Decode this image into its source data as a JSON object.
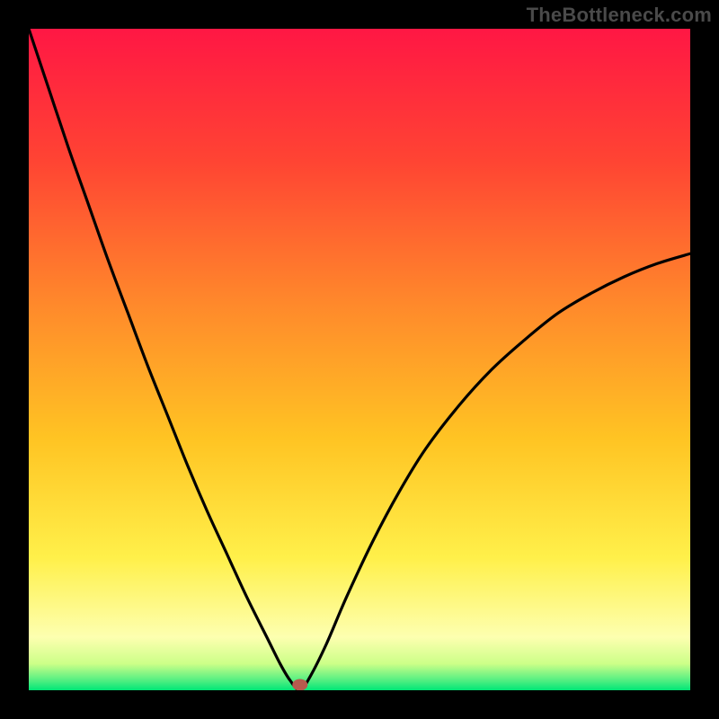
{
  "watermark": "TheBottleneck.com",
  "colors": {
    "gradient_stops": [
      {
        "offset": 0,
        "color": "#ff1744"
      },
      {
        "offset": 0.2,
        "color": "#ff4433"
      },
      {
        "offset": 0.42,
        "color": "#ff8a2b"
      },
      {
        "offset": 0.62,
        "color": "#ffc423"
      },
      {
        "offset": 0.8,
        "color": "#fff04a"
      },
      {
        "offset": 0.92,
        "color": "#fdffb0"
      },
      {
        "offset": 0.96,
        "color": "#ccff88"
      },
      {
        "offset": 0.985,
        "color": "#53ef82"
      },
      {
        "offset": 1.0,
        "color": "#00e676"
      }
    ],
    "curve": "#000000",
    "marker": "#b75a4e",
    "frame": "#000000"
  },
  "chart_data": {
    "type": "line",
    "title": "",
    "xlabel": "",
    "ylabel": "",
    "xlim": [
      0,
      1
    ],
    "ylim": [
      0,
      1
    ],
    "legend": false,
    "grid": false,
    "description": "V-shaped bottleneck curve on a vertical rainbow gradient. Minimum (y≈0) occurs near x≈0.41; left branch rises steeply to y=1 at x=0; right branch rises with decreasing slope toward y≈0.66 at x=1.",
    "min_point": {
      "x": 0.41,
      "y": 0.0
    },
    "series": [
      {
        "name": "bottleneck",
        "x": [
          0.0,
          0.03,
          0.06,
          0.09,
          0.12,
          0.15,
          0.18,
          0.21,
          0.24,
          0.27,
          0.3,
          0.33,
          0.36,
          0.38,
          0.395,
          0.41,
          0.425,
          0.45,
          0.48,
          0.52,
          0.56,
          0.6,
          0.65,
          0.7,
          0.75,
          0.8,
          0.85,
          0.9,
          0.95,
          1.0
        ],
        "y": [
          1.0,
          0.91,
          0.82,
          0.735,
          0.65,
          0.57,
          0.49,
          0.415,
          0.34,
          0.27,
          0.205,
          0.14,
          0.08,
          0.04,
          0.015,
          0.0,
          0.02,
          0.07,
          0.14,
          0.225,
          0.3,
          0.365,
          0.43,
          0.485,
          0.53,
          0.57,
          0.6,
          0.625,
          0.645,
          0.66
        ]
      }
    ]
  }
}
